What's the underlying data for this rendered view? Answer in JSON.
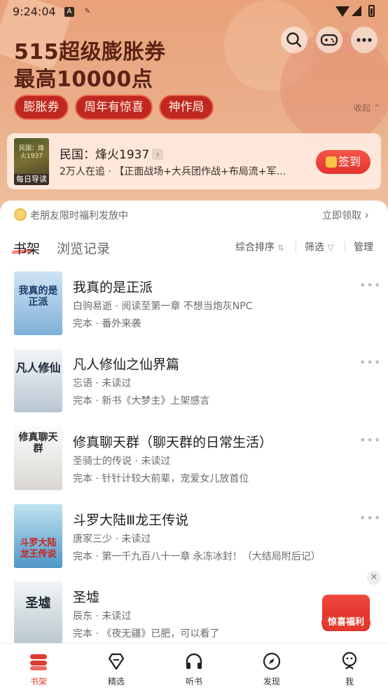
{
  "status_bar": {
    "time": "9:24:04"
  },
  "banner": {
    "line1": "515超级膨胀券",
    "line2": "最高10000点",
    "chips": [
      "膨胀券",
      "周年有惊喜",
      "神作局"
    ],
    "collapse_label": "收起"
  },
  "reading_card": {
    "title": "民国：烽火1937",
    "subtitle": "2万人在追 · 【正面战场+大兵团作战+布局流+军…",
    "badge": "每日导读",
    "sign_label": "签到",
    "cover_text": "民国：烽火1937"
  },
  "notice": {
    "text": "老朋友限时福利发放中",
    "action": "立即领取"
  },
  "tabs": {
    "active": "书架",
    "other": "浏览记录"
  },
  "toolbar": {
    "sort": "综合排序",
    "filter": "筛选",
    "manage": "管理"
  },
  "books": [
    {
      "title": "我真的是正派",
      "line2": "白驹易逝 · 阅读至第一章 不想当炮灰NPC",
      "line3": "完本 · 番外来袭",
      "cover_text": "我真的是正派",
      "cover_bg": "#9fc7e8",
      "cover_fg": "#1c3c6e"
    },
    {
      "title": "凡人修仙之仙界篇",
      "line2": "忘语 · 未读过",
      "line3": "完本 · 新书《大梦主》上架感言",
      "cover_text": "凡人修仙",
      "cover_bg": "#dfe6ee",
      "cover_fg": "#1a2638"
    },
    {
      "title": "修真聊天群（聊天群的日常生活）",
      "line2": "圣骑士的传说 · 未读过",
      "line3": "完本 · 针针计较大前辈，宠爱女儿放首位",
      "cover_text": "修真聊天群",
      "cover_bg": "#f2f2f0",
      "cover_fg": "#2b2b2b"
    },
    {
      "title": "斗罗大陆Ⅲ龙王传说",
      "line2": "唐家三少 · 未读过",
      "line3": "完本 · 第一千九百八十一章 永冻冰封！（大结局附后记）",
      "cover_text": "斗罗大陆 龙王传说",
      "cover_bg": "#bfe3ef",
      "cover_fg": "#c8241e"
    },
    {
      "title": "圣墟",
      "line2": "辰东 · 未读过",
      "line3": "完本 · 《夜无疆》已肥，可以看了",
      "cover_text": "圣墟",
      "cover_bg": "#e8eef0",
      "cover_fg": "#1e2a30"
    }
  ],
  "floating": {
    "label": "惊喜福利"
  },
  "nav": [
    {
      "label": "书架",
      "icon": "bookshelf-icon",
      "active": true
    },
    {
      "label": "精选",
      "icon": "diamond-icon",
      "active": false
    },
    {
      "label": "听书",
      "icon": "headphones-icon",
      "active": false
    },
    {
      "label": "发现",
      "icon": "compass-icon",
      "active": false
    },
    {
      "label": "我",
      "icon": "profile-icon",
      "active": false
    }
  ],
  "colors": {
    "accent": "#e23a2e",
    "banner": "#e9a27a",
    "chip": "#c0271f"
  }
}
